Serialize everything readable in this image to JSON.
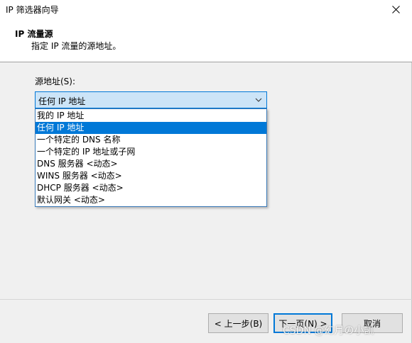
{
  "window": {
    "title": "IP 筛选器向导"
  },
  "header": {
    "title": "IP 流量源",
    "subtitle": "指定 IP 流量的源地址。"
  },
  "source": {
    "label": "源地址(S):",
    "selected_value": "任何 IP 地址",
    "options": [
      {
        "label": "我的 IP 地址",
        "selected": false
      },
      {
        "label": "任何 IP 地址",
        "selected": true
      },
      {
        "label": "一个特定的 DNS 名称",
        "selected": false
      },
      {
        "label": "一个特定的 IP 地址或子网",
        "selected": false
      },
      {
        "label": "DNS 服务器 <动态>",
        "selected": false
      },
      {
        "label": "WINS 服务器 <动态>",
        "selected": false
      },
      {
        "label": "DHCP 服务器 <动态>",
        "selected": false
      },
      {
        "label": "默认网关 <动态>",
        "selected": false
      }
    ]
  },
  "buttons": {
    "back": "< 上一步(B)",
    "next": "下一页(N) >",
    "cancel": "取消"
  },
  "watermark": "CSDN @幻月の小凯",
  "colors": {
    "accent": "#0078d7",
    "combo_bg": "#cce4f7"
  }
}
